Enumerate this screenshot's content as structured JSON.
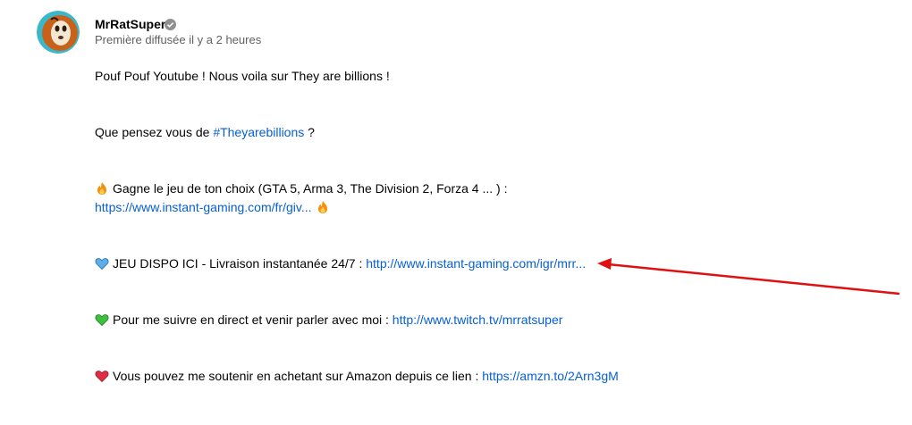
{
  "post": {
    "channel_name": "MrRatSuper",
    "subtitle": "Première diffusée il y a 2 heures"
  },
  "description": {
    "line1": "Pouf Pouf Youtube ! Nous voila sur They are billions !",
    "line2_text": "Que pensez vous de ",
    "line2_hashtag": "#Theyarebillions",
    "line2_end": " ?",
    "line3_text": "Gagne le jeu de ton choix (GTA 5, Arma 3, The Division 2, Forza 4 ... ) :",
    "line3_link": "https://www.instant-gaming.com/fr/giv...",
    "line4_text": "JEU DISPO ICI - Livraison instantanée 24/7 : ",
    "line4_link": "http://www.instant-gaming.com/igr/mrr...",
    "line5_text": "Pour me suivre en direct et venir parler avec moi : ",
    "line5_link": "http://www.twitch.tv/mrratsuper",
    "line6_text": "Vous pouvez me soutenir en achetant sur Amazon depuis ce lien : ",
    "line6_link": "https://amzn.to/2Arn3gM"
  },
  "icons": {
    "verified": "verified-check-icon",
    "fire": "fire-emoji-icon",
    "blue_heart": "blue-heart-icon",
    "green_heart": "green-heart-icon",
    "red_heart": "red-heart-icon"
  },
  "colors": {
    "link": "#065fd4",
    "secondary_text": "#606060",
    "arrow": "#e01010"
  }
}
